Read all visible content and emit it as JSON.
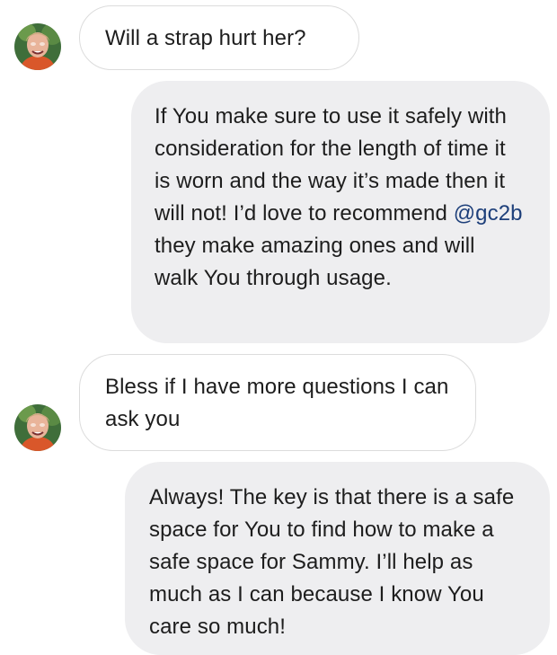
{
  "conversation": {
    "messages": [
      {
        "direction": "incoming",
        "text": "Will a strap hurt her?"
      },
      {
        "direction": "outgoing",
        "text_before_mention": "If You make sure to use it safely with consideration for the length of time it is worn and the way it’s made then it will not! I’d love to recommend ",
        "mention": "@gc2b",
        "text_after_mention": " they make amazing ones and will walk You through usage."
      },
      {
        "direction": "incoming",
        "text": "Bless if I have more questions I can ask you"
      },
      {
        "direction": "outgoing",
        "text": "Always! The key is that there is a safe space for You to find how to make a safe space for Sammy. I’ll help as much as I can because I know You care so much!"
      }
    ]
  },
  "colors": {
    "incoming_bubble_bg": "#ffffff",
    "incoming_bubble_border": "#dcdcdc",
    "outgoing_bubble_bg": "#eeeef0",
    "mention": "#1d3f7a",
    "text": "#1d1d1d"
  },
  "icons": {
    "sender_avatar": "avatar-photo-icon"
  }
}
